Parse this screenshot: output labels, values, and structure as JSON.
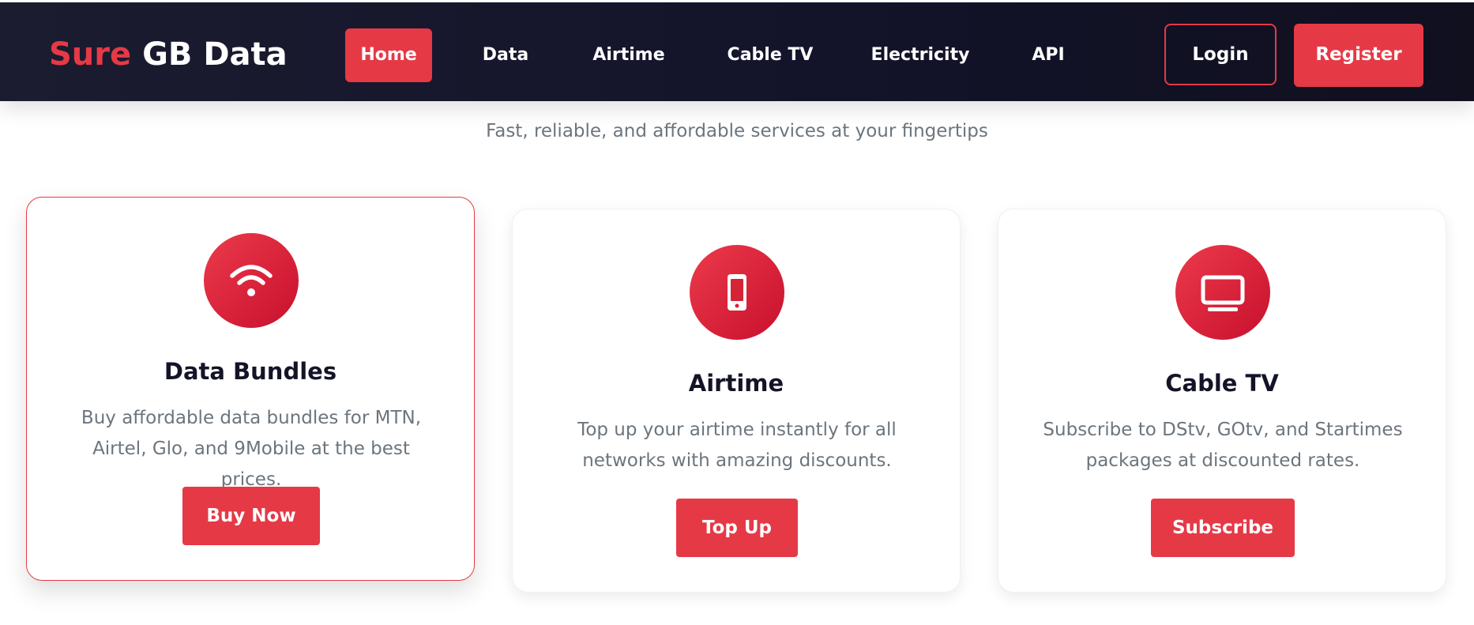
{
  "brand": {
    "part1": "Sure",
    "part2": "GB Data",
    "accent_color": "#e63946"
  },
  "nav": {
    "items": [
      {
        "label": "Home",
        "active": true
      },
      {
        "label": "Data",
        "active": false
      },
      {
        "label": "Airtime",
        "active": false
      },
      {
        "label": "Cable TV",
        "active": false
      },
      {
        "label": "Electricity",
        "active": false
      },
      {
        "label": "API",
        "active": false
      }
    ],
    "login_label": "Login",
    "register_label": "Register"
  },
  "hero": {
    "subtitle": "Fast, reliable, and affordable services at your fingertips"
  },
  "services": [
    {
      "icon": "wifi-icon",
      "title": "Data Bundles",
      "description": "Buy affordable data bundles for MTN, Airtel, Glo, and 9Mobile at the best prices.",
      "button_label": "Buy Now"
    },
    {
      "icon": "mobile-phone-icon",
      "title": "Airtime",
      "description": "Top up your airtime instantly for all networks with amazing discounts.",
      "button_label": "Top Up"
    },
    {
      "icon": "tv-icon",
      "title": "Cable TV",
      "description": "Subscribe to DStv, GOtv, and Startimes packages at discounted rates.",
      "button_label": "Subscribe"
    }
  ]
}
